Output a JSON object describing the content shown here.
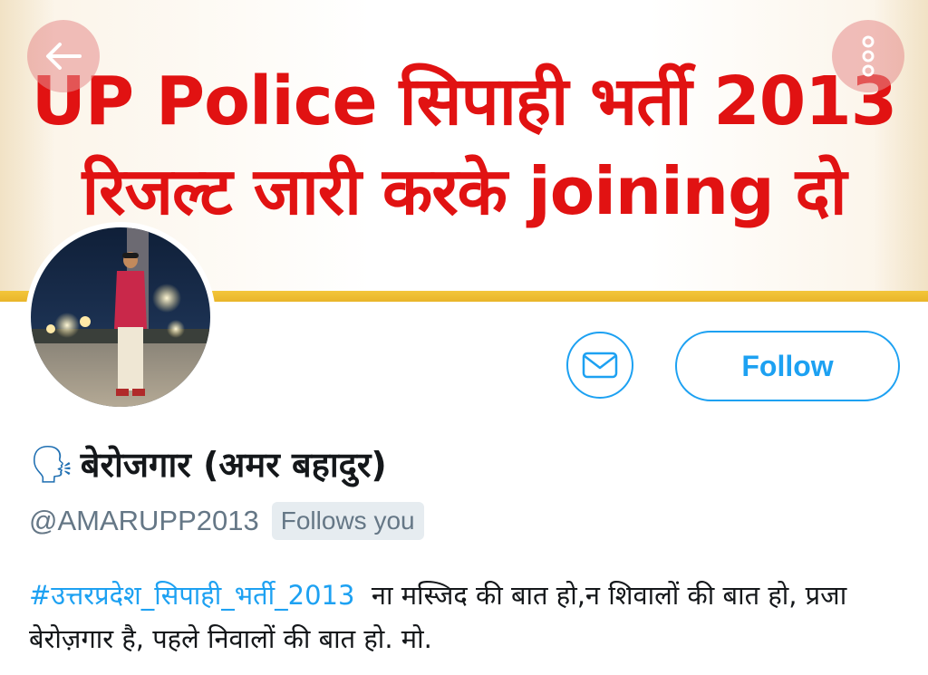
{
  "banner": {
    "line1": "UP Police सिपाही भर्ती 2013",
    "line2": "रिजल्ट जारी करके joining दो",
    "text_color": "#e11212",
    "bar_color": "#f3c63b"
  },
  "nav": {
    "back_icon": "arrow-left-icon",
    "more_icon": "vertical-ellipsis-icon"
  },
  "actions": {
    "message_icon": "envelope-icon",
    "follow_label": "Follow",
    "accent": "#1da1f2"
  },
  "profile": {
    "emoji": "🗣",
    "display_name": "बेरोजगार (अमर बहादुर)",
    "handle": "@AMARUPP2013",
    "follows_you": "Follows you",
    "bio_hashtag": "#उत्तरप्रदेश_सिपाही_भर्ती_2013",
    "bio_text": "ना मस्जिद की बात हो,न शिवालों की बात हो, प्रजा बेरोज़गार है, पहले निवालों की बात हो. मो."
  }
}
